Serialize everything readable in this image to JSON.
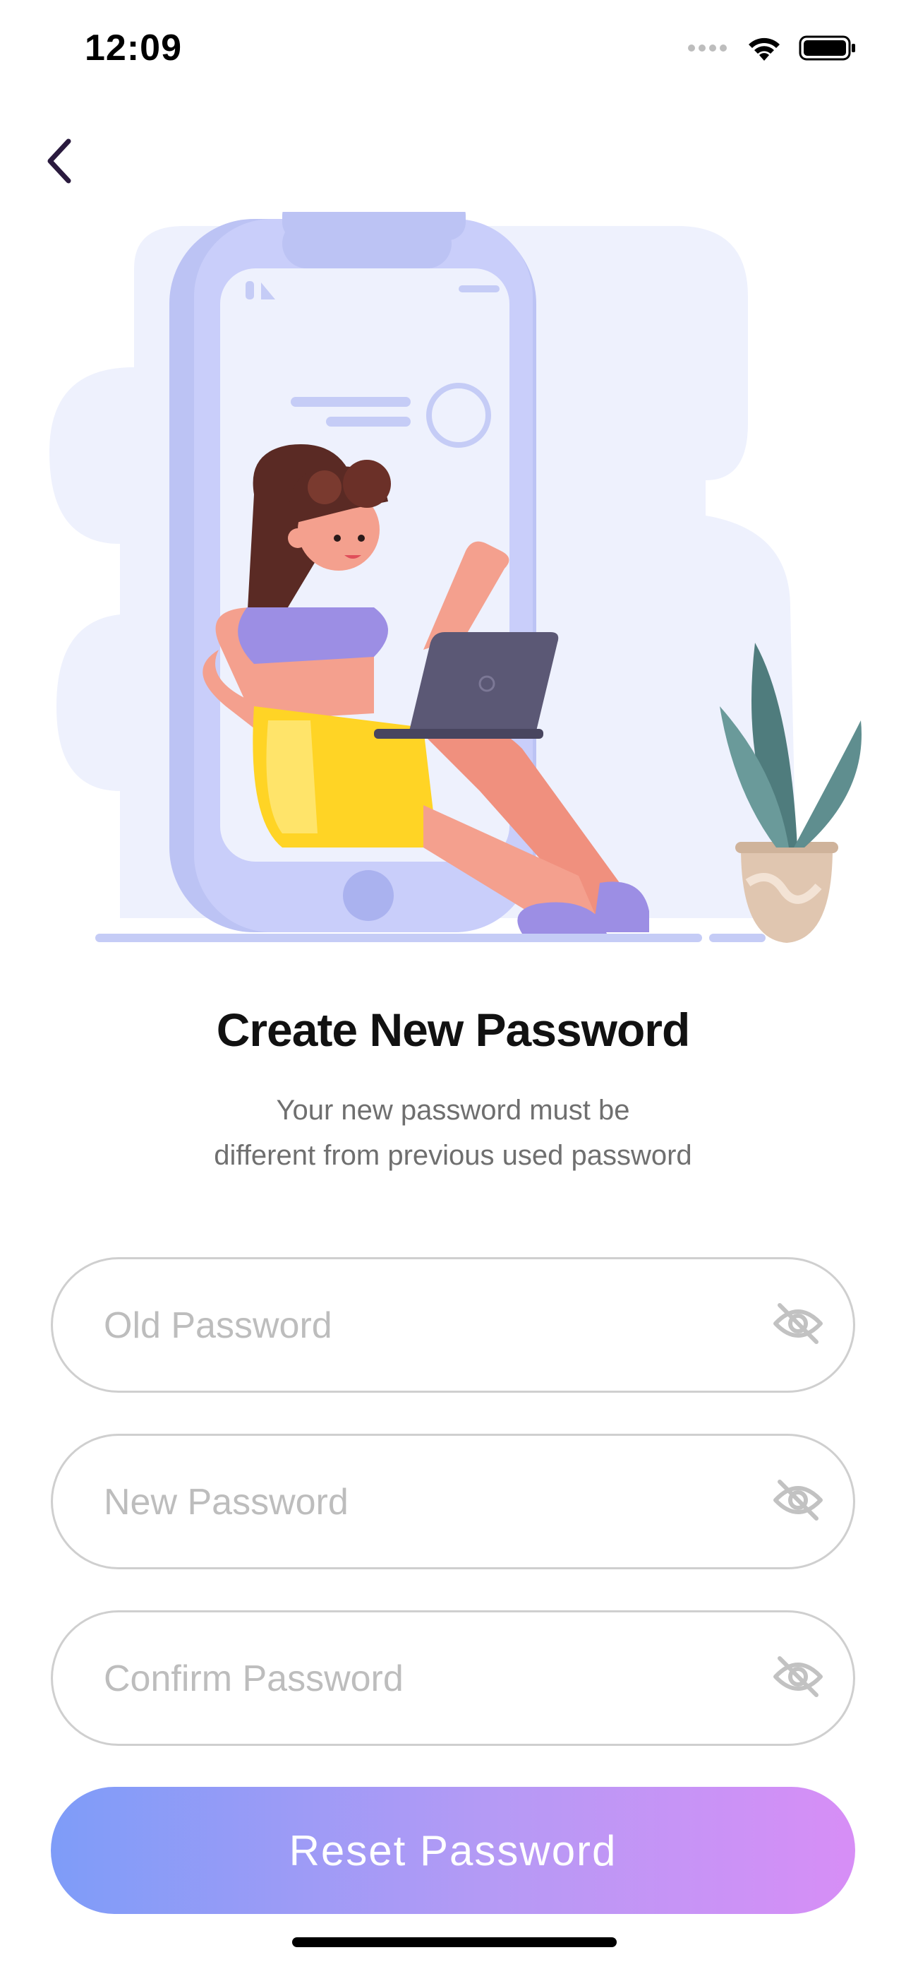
{
  "status_bar": {
    "time": "12:09",
    "icons": [
      "signal-dots-icon",
      "wifi-icon",
      "battery-icon"
    ]
  },
  "nav": {
    "back_icon": "chevron-left-icon",
    "back_color": "#2a1a3e"
  },
  "illustration": {
    "name": "woman-with-laptop-in-phone-illustration"
  },
  "heading": {
    "title": "Create New Password",
    "subtitle_line1": "Your new password must be",
    "subtitle_line2": "different from previous used password"
  },
  "form": {
    "old_password": {
      "placeholder": "Old Password",
      "value": ""
    },
    "new_password": {
      "placeholder": "New Password",
      "value": ""
    },
    "confirm_password": {
      "placeholder": "Confirm Password",
      "value": ""
    },
    "toggle_icon": "eye-slash-icon",
    "submit_label": "Reset Password"
  },
  "colors": {
    "button_gradient_start": "#7e9cf8",
    "button_gradient_end": "#d78ef6",
    "title": "#111111",
    "subtitle": "#6f6f6f",
    "field_border": "#cfcfcf",
    "placeholder": "#bdbdbd"
  }
}
